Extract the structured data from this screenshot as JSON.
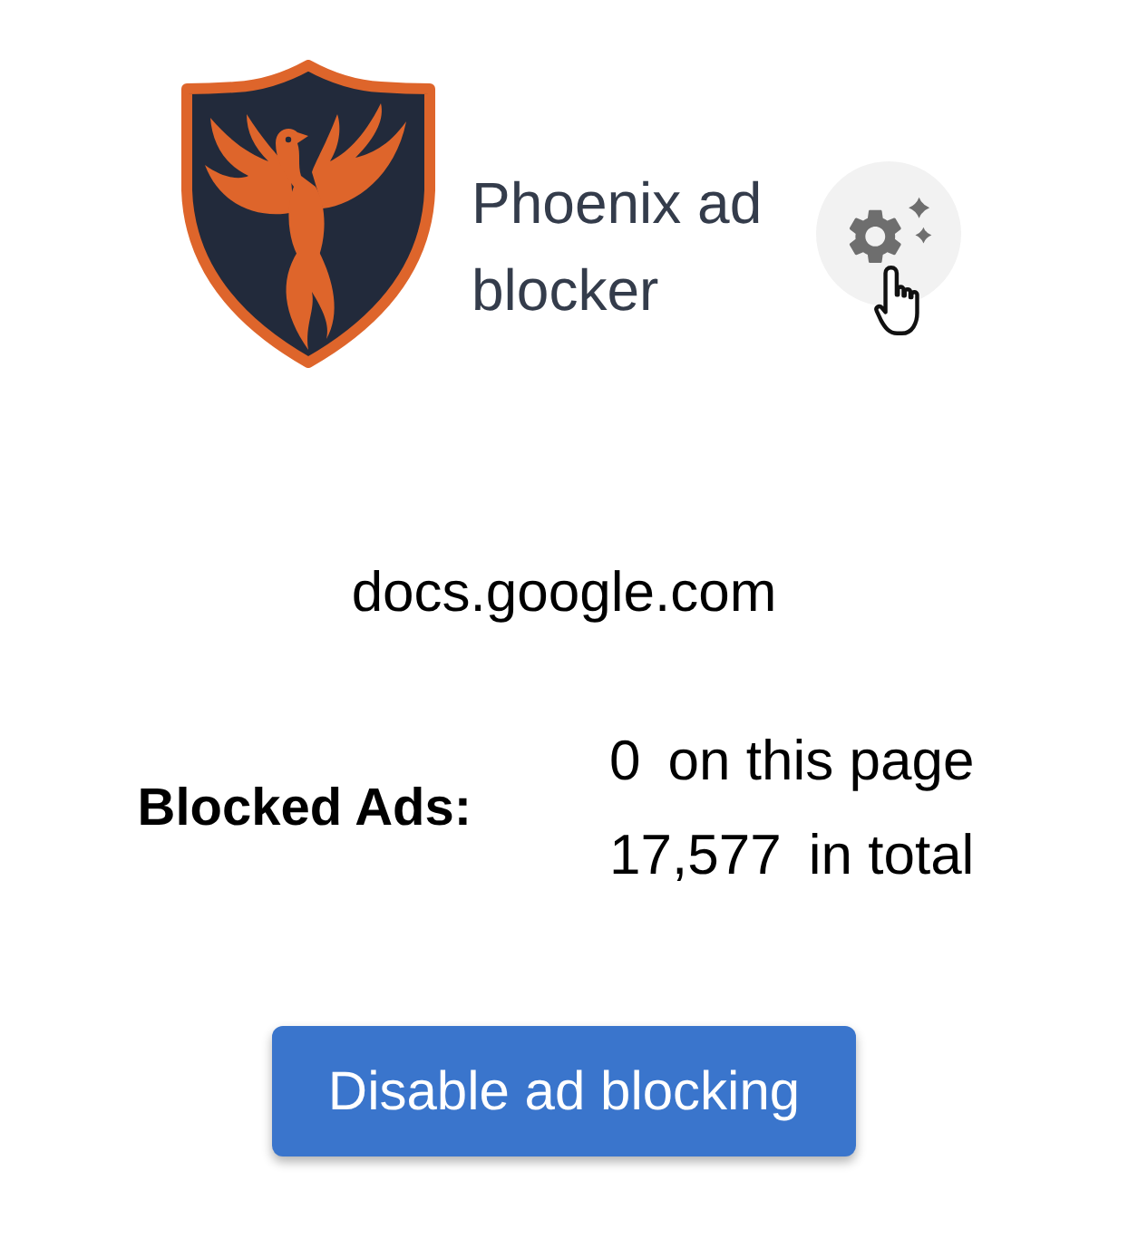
{
  "header": {
    "title": "Phoenix ad blocker"
  },
  "site": {
    "domain": "docs.google.com"
  },
  "stats": {
    "label": "Blocked Ads:",
    "rows": [
      {
        "count": "0",
        "text": "on this page"
      },
      {
        "count": "17,577",
        "text": "in total"
      }
    ]
  },
  "action_button": {
    "label": "Disable ad blocking"
  }
}
